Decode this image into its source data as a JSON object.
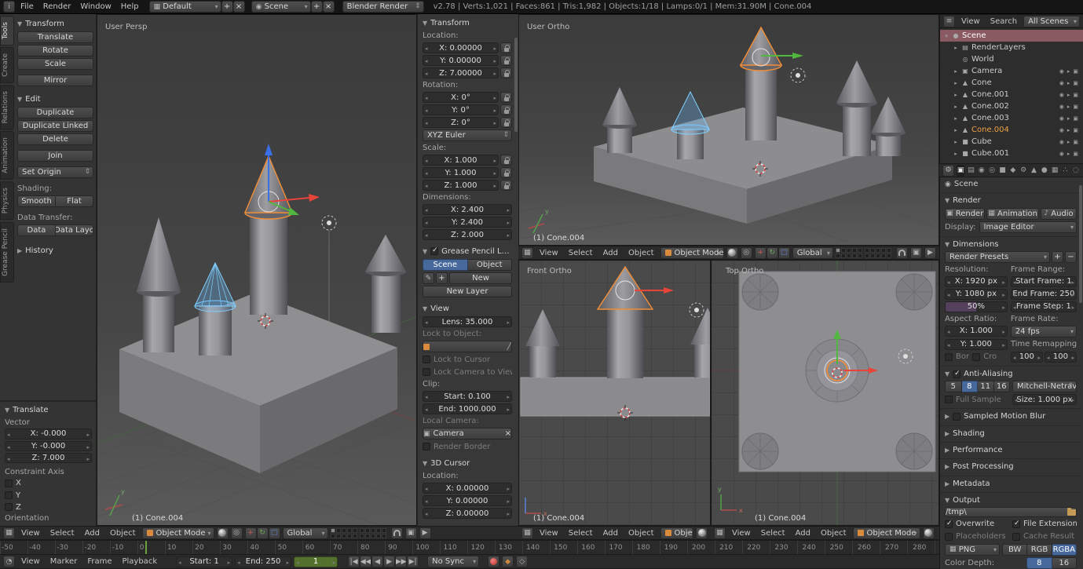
{
  "topbar": {
    "menus": [
      "File",
      "Render",
      "Window",
      "Help"
    ],
    "layout": "Default",
    "scene": "Scene",
    "engine": "Blender Render",
    "stats": "v2.78 | Verts:1,021 | Faces:861 | Tris:1,982 | Objects:1/18 | Lamps:0/1 | Mem:31.90M | Cone.004"
  },
  "toolshelf": {
    "tabs": [
      "Tools",
      "Create",
      "Relations",
      "Animation",
      "Physics",
      "Grease Pencil"
    ],
    "transform": {
      "title": "Transform",
      "translate": "Translate",
      "rotate": "Rotate",
      "scale": "Scale",
      "mirror": "Mirror"
    },
    "edit": {
      "title": "Edit",
      "duplicate": "Duplicate",
      "duplicate_linked": "Duplicate Linked",
      "delete": "Delete",
      "join": "Join",
      "set_origin": "Set Origin"
    },
    "shading_label": "Shading:",
    "smooth": "Smooth",
    "flat": "Flat",
    "data_transfer_label": "Data Transfer:",
    "data": "Data",
    "data_layout": "Data Layo",
    "history": "History",
    "redo": {
      "title": "Translate",
      "vector_label": "Vector",
      "x": "X: -0.000",
      "y": "Y: -0.000",
      "z": "Z: 7.000",
      "constraint_label": "Constraint Axis",
      "ax": "X",
      "ay": "Y",
      "az": "Z",
      "orientation_label": "Orientation"
    }
  },
  "npanel": {
    "transform_title": "Transform",
    "location_label": "Location:",
    "loc_x": "X: 0.00000",
    "loc_y": "Y: 0.00000",
    "loc_z": "Z: 7.00000",
    "rotation_label": "Rotation:",
    "rot_x": "X: 0°",
    "rot_y": "Y: 0°",
    "rot_z": "Z: 0°",
    "rotation_mode": "XYZ Euler",
    "scale_label": "Scale:",
    "scale_x": "X: 1.000",
    "scale_y": "Y: 1.000",
    "scale_z": "Z: 1.000",
    "dimensions_label": "Dimensions:",
    "dim_x": "X: 2.400",
    "dim_y": "Y: 2.400",
    "dim_z": "Z: 2.000",
    "grease_title": "Grease Pencil Layer",
    "gp_scene": "Scene",
    "gp_object": "Object",
    "gp_new": "New",
    "gp_new_layer": "New Layer",
    "view_title": "View",
    "lens": "Lens: 35.000",
    "lock_to_object": "Lock to Object:",
    "lock_to_cursor": "Lock to Cursor",
    "lock_camera": "Lock Camera to View",
    "clip_label": "Clip:",
    "clip_start": "Start: 0.100",
    "clip_end": "End: 1000.000",
    "local_camera_label": "Local Camera:",
    "camera": "Camera",
    "render_border": "Render Border",
    "cursor_title": "3D Cursor",
    "cursor_location_label": "Location:",
    "cur_x": "X: 0.00000",
    "cur_y": "Y: 0.00000",
    "cur_z": "Z: 0.00000"
  },
  "viewports": {
    "main_label": "User Persp",
    "main_object": "(1) Cone.004",
    "ortho_label": "User Ortho",
    "ortho_object": "(1) Cone.004",
    "front_label": "Front Ortho",
    "front_object": "(1) Cone.004",
    "top_label": "Top Ortho",
    "top_object": "(1) Cone.004",
    "header_menus": [
      "View",
      "Select",
      "Add",
      "Object"
    ],
    "mode": "Object Mode",
    "orientation": "Global"
  },
  "outliner": {
    "menus": [
      "View",
      "Search",
      "All Scenes"
    ],
    "items": [
      {
        "label": "Scene",
        "icon": "scene",
        "depth": 0,
        "selected": true,
        "toggles": false,
        "expand": "▾"
      },
      {
        "label": "RenderLayers",
        "icon": "renderlayers",
        "depth": 1,
        "toggles": false,
        "expand": "▸"
      },
      {
        "label": "World",
        "icon": "world",
        "depth": 1,
        "toggles": false,
        "expand": ""
      },
      {
        "label": "Camera",
        "icon": "camera",
        "depth": 1,
        "toggles": true,
        "expand": "▸"
      },
      {
        "label": "Cone",
        "icon": "mesh",
        "depth": 1,
        "toggles": true,
        "expand": "▸"
      },
      {
        "label": "Cone.001",
        "icon": "mesh",
        "depth": 1,
        "toggles": true,
        "expand": "▸"
      },
      {
        "label": "Cone.002",
        "icon": "mesh",
        "depth": 1,
        "toggles": true,
        "expand": "▸"
      },
      {
        "label": "Cone.003",
        "icon": "mesh",
        "depth": 1,
        "toggles": true,
        "expand": "▸"
      },
      {
        "label": "Cone.004",
        "icon": "mesh",
        "depth": 1,
        "toggles": true,
        "active": true,
        "expand": "▸"
      },
      {
        "label": "Cube",
        "icon": "cube",
        "depth": 1,
        "toggles": true,
        "expand": "▸"
      },
      {
        "label": "Cube.001",
        "icon": "cube",
        "depth": 1,
        "toggles": true,
        "expand": "▸"
      }
    ]
  },
  "properties": {
    "context": "Scene",
    "render_title": "Render",
    "render_btn": "Render",
    "animation_btn": "Animation",
    "audio_btn": "Audio",
    "display_label": "Display:",
    "display_value": "Image Editor",
    "dimensions_title": "Dimensions",
    "render_presets": "Render Presets",
    "resolution_label": "Resolution:",
    "res_x": "X: 1920 px",
    "res_y": "Y: 1080 px",
    "res_pct": "50%",
    "frame_range_label": "Frame Range:",
    "start_frame": "Start Frame: 1",
    "end_frame": "End Frame: 250",
    "frame_step": "Frame Step: 1",
    "aspect_label": "Aspect Ratio:",
    "aspect_x": "X: 1.000",
    "aspect_y": "Y: 1.000",
    "frame_rate_label": "Frame Rate:",
    "fps": "24 fps",
    "time_remap_label": "Time Remapping:",
    "remap_old": "100",
    "remap_new": "100",
    "border": "Bor",
    "crop": "Cro",
    "aa_title": "Anti-Aliasing",
    "aa_samples": [
      "5",
      "8",
      "11",
      "16"
    ],
    "aa_filter": "Mitchell-Netrav",
    "full_sample": "Full Sample",
    "aa_size": "Size: 1.000 px",
    "motion_blur_title": "Sampled Motion Blur",
    "shading_title": "Shading",
    "performance_title": "Performance",
    "post_title": "Post Processing",
    "metadata_title": "Metadata",
    "output_title": "Output",
    "output_path": "/tmp\\",
    "overwrite": "Overwrite",
    "file_extensions": "File Extensions",
    "placeholders": "Placeholders",
    "cache_result": "Cache Result",
    "format": "PNG",
    "bw": "BW",
    "rgb": "RGB",
    "rgba": "RGBA",
    "color_depth_label": "Color Depth:",
    "depth_8": "8",
    "depth_16": "16"
  },
  "timeline": {
    "menus": [
      "View",
      "Marker",
      "Frame",
      "Playback"
    ],
    "start": "Start: 1",
    "end": "End: 250",
    "current": "1",
    "sync": "No Sync",
    "ruler": [
      "-50",
      "-40",
      "-30",
      "-20",
      "-10",
      "0",
      "10",
      "20",
      "30",
      "40",
      "50",
      "60",
      "70",
      "80",
      "90",
      "100",
      "110",
      "120",
      "130",
      "140",
      "150",
      "160",
      "170",
      "180",
      "190",
      "200",
      "210",
      "220",
      "230",
      "240",
      "250",
      "260",
      "270",
      "280"
    ]
  }
}
